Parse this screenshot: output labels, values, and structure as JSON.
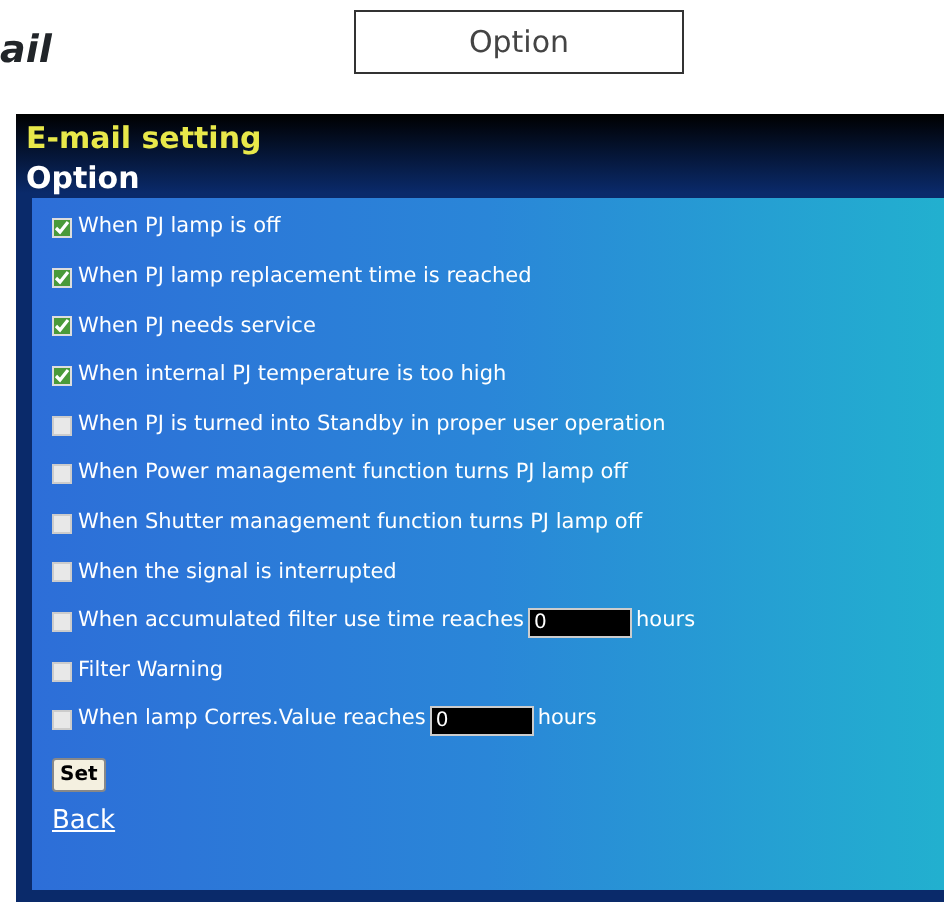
{
  "heading": "ail",
  "tab": {
    "label": "Option"
  },
  "panel": {
    "title": "E-mail setting",
    "subtitle": "Option",
    "options": [
      {
        "kind": "checkbox",
        "label": "When PJ lamp is off",
        "checked": true
      },
      {
        "kind": "checkbox",
        "label": "When PJ lamp replacement time is reached",
        "checked": true
      },
      {
        "kind": "checkbox",
        "label": "When PJ needs service",
        "checked": true
      },
      {
        "kind": "checkbox",
        "label": "When internal PJ temperature is too high",
        "checked": true
      },
      {
        "kind": "checkbox",
        "label": "When PJ is turned into Standby in proper user operation",
        "checked": false
      },
      {
        "kind": "checkbox",
        "label": "When Power management function turns PJ lamp off",
        "checked": false
      },
      {
        "kind": "checkbox",
        "label": "When Shutter management function turns PJ lamp off",
        "checked": false
      },
      {
        "kind": "checkbox",
        "label": "When the signal is interrupted",
        "checked": false
      },
      {
        "kind": "hours",
        "label": "When accumulated filter use time reaches",
        "value": "0",
        "suffix": "hours",
        "checked": false
      },
      {
        "kind": "checkbox",
        "label": "Filter Warning",
        "checked": false
      },
      {
        "kind": "hours",
        "label": "When lamp Corres.Value reaches",
        "value": "0",
        "suffix": "hours",
        "checked": false
      }
    ],
    "set_button": "Set",
    "back_link": "Back"
  }
}
